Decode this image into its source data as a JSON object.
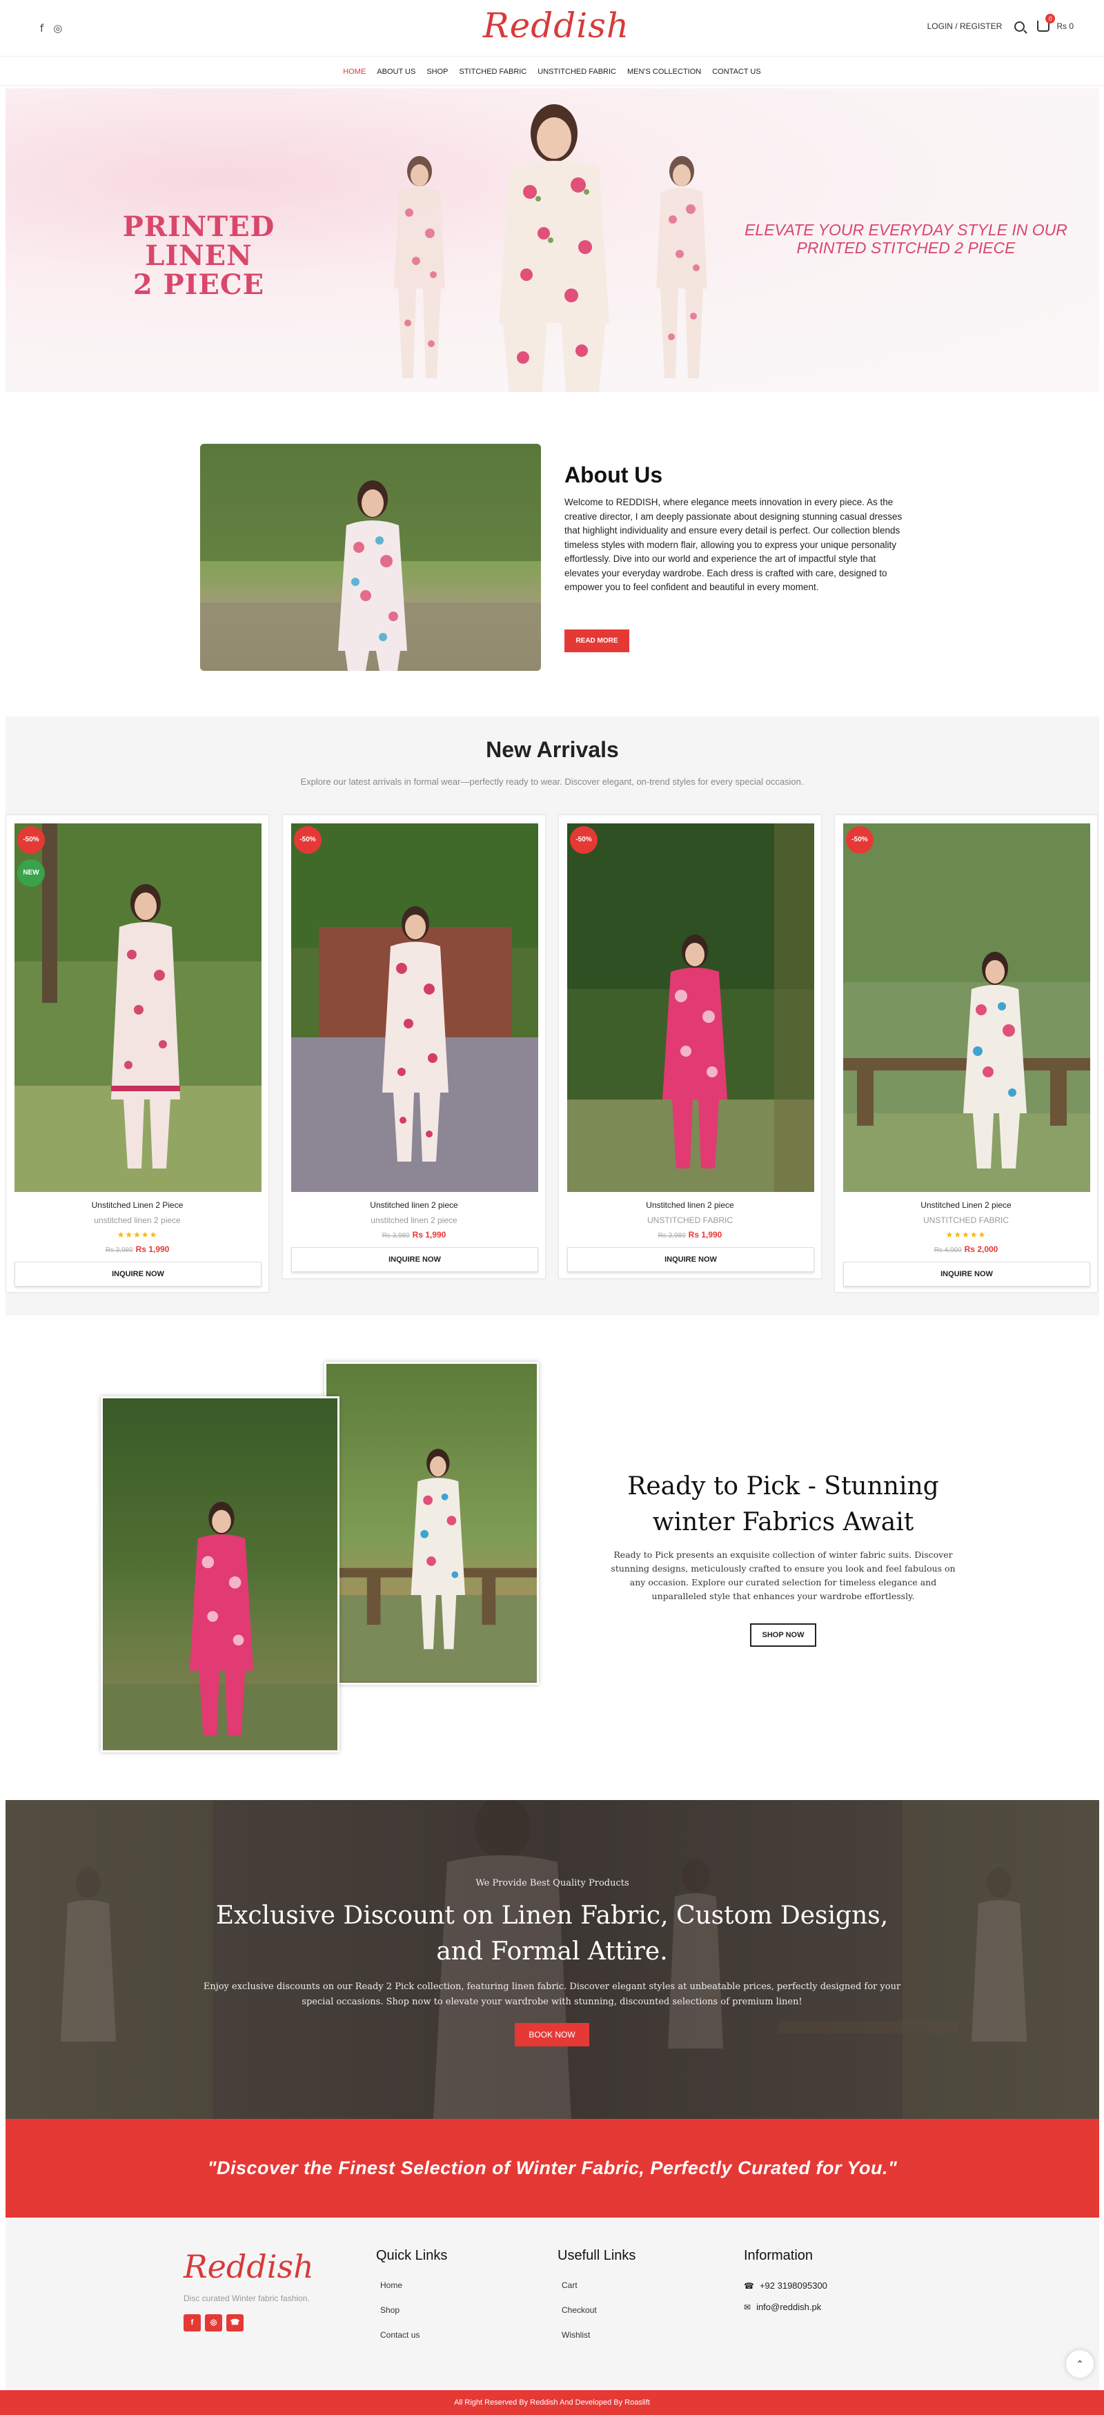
{
  "header": {
    "logo": "Reddish",
    "login_label": "LOGIN / REGISTER",
    "cart_count": "0",
    "cart_total": "Rs 0",
    "social_icons": [
      "facebook-icon",
      "instagram-icon"
    ]
  },
  "nav": {
    "items": [
      {
        "label": "HOME",
        "active": true
      },
      {
        "label": "ABOUT US"
      },
      {
        "label": "SHOP"
      },
      {
        "label": "STITCHED FABRIC"
      },
      {
        "label": "UNSTITCHED FABRIC"
      },
      {
        "label": "MEN'S COLLECTION"
      },
      {
        "label": "CONTACT US"
      }
    ]
  },
  "hero": {
    "title_line1": "PRINTED LINEN",
    "title_line2": "2 PIECE",
    "subtitle": "ELEVATE YOUR EVERYDAY STYLE IN OUR PRINTED STITCHED 2 PIECE"
  },
  "about": {
    "title": "About Us",
    "text": "Welcome to REDDISH, where elegance meets innovation in every piece. As the creative director, I am deeply passionate about designing stunning casual dresses that highlight individuality and ensure every detail is perfect. Our collection blends timeless styles with modern flair, allowing you to express your unique personality effortlessly. Dive into our world and experience the art of impactful style that elevates your everyday wardrobe. Each dress is crafted with care, designed to empower you to feel confident and beautiful in every moment.",
    "button": "READ MORE"
  },
  "arrivals": {
    "title": "New Arrivals",
    "subtitle": "Explore our latest arrivals in formal wear—perfectly ready to wear. Discover elegant, on-trend styles for every special occasion.",
    "products": [
      {
        "name": "Unstitched Linen 2 Piece",
        "category": "unstitched linen 2 piece",
        "stars": "★★★★★",
        "old_price": "Rs 3,980",
        "price": "Rs 1,990",
        "sale_badge": "-50%",
        "new_badge": "NEW",
        "button": "INQUIRE NOW",
        "has_stars": true
      },
      {
        "name": "Unstitched linen 2 piece",
        "category": "unstitched linen 2 piece",
        "stars": "",
        "old_price": "Rs 3,980",
        "price": "Rs 1,990",
        "sale_badge": "-50%",
        "new_badge": "",
        "button": "INQUIRE NOW",
        "has_stars": false
      },
      {
        "name": "Unstitched linen 2 piece",
        "category": "UNSTITCHED FABRIC",
        "stars": "",
        "old_price": "Rs 3,980",
        "price": "Rs 1,990",
        "sale_badge": "-50%",
        "new_badge": "",
        "button": "INQUIRE NOW",
        "has_stars": false
      },
      {
        "name": "Unstitched Linen 2 piece",
        "category": "UNSTITCHED FABRIC",
        "stars": "★★★★★",
        "old_price": "Rs 4,000",
        "price": "Rs 2,000",
        "sale_badge": "-50%",
        "new_badge": "",
        "button": "INQUIRE NOW",
        "has_stars": true
      }
    ]
  },
  "ready_pick": {
    "title": "Ready to Pick - Stunning winter Fabrics Await",
    "text": "Ready to Pick presents an exquisite collection of winter fabric suits. Discover stunning designs, meticulously crafted to ensure you look and feel fabulous on any occasion. Explore our curated selection for timeless elegance and unparalleled style that enhances your wardrobe effortlessly.",
    "button": "SHOP NOW"
  },
  "discount": {
    "small": "We Provide Best Quality Products",
    "title": "Exclusive Discount on Linen Fabric, Custom Designs, and Formal Attire.",
    "text": "Enjoy exclusive discounts on our Ready 2 Pick collection, featuring linen fabric. Discover elegant styles at unbeatable prices, perfectly designed for your special occasions. Shop now to elevate your wardrobe with stunning, discounted selections of premium linen!",
    "button": "BOOK NOW"
  },
  "quote": "\"Discover the Finest Selection of Winter Fabric, Perfectly Curated for You.\"",
  "footer": {
    "logo": "Reddish",
    "tagline": "Disc curated Winter fabric fashion.",
    "quick_links_title": "Quick Links",
    "quick_links": [
      "Home",
      "Shop",
      "Contact us"
    ],
    "useful_links_title": "Usefull Links",
    "useful_links": [
      "Cart",
      "Checkout",
      "Wishlist"
    ],
    "info_title": "Information",
    "phone": "+92 3198095300",
    "email": "info@reddish.pk"
  },
  "copyright": "All Right Reserved By Reddish And Developed By Roaslift",
  "colors": {
    "accent": "#e53935",
    "brand_pink": "#d9476b"
  }
}
